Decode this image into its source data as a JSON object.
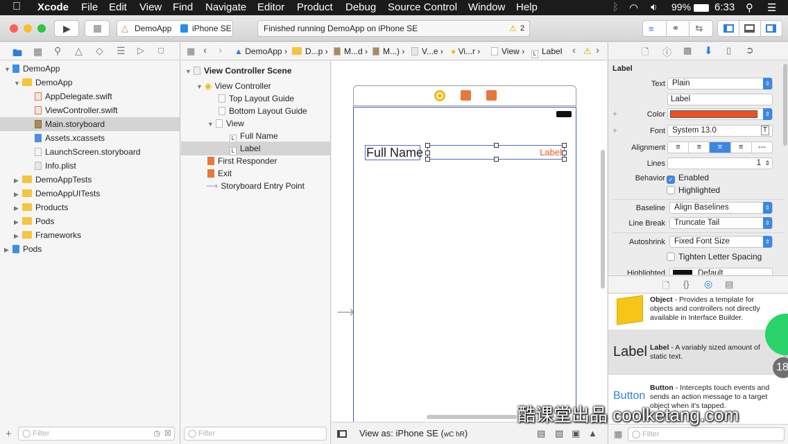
{
  "menubar": {
    "app": "Xcode",
    "items": [
      "File",
      "Edit",
      "View",
      "Find",
      "Navigate",
      "Editor",
      "Product",
      "Debug",
      "Source Control",
      "Window",
      "Help"
    ],
    "battery": "99%",
    "time": "6:33"
  },
  "toolbar": {
    "scheme": "DemoApp",
    "device": "iPhone SE",
    "status": "Finished running DemoApp on iPhone SE",
    "warning_count": "2"
  },
  "navigator": {
    "items": [
      {
        "label": "DemoApp",
        "kind": "project"
      },
      {
        "label": "DemoApp",
        "kind": "folder"
      },
      {
        "label": "AppDelegate.swift",
        "kind": "swift"
      },
      {
        "label": "ViewController.swift",
        "kind": "swift"
      },
      {
        "label": "Main.storyboard",
        "kind": "storyboard"
      },
      {
        "label": "Assets.xcassets",
        "kind": "assets"
      },
      {
        "label": "LaunchScreen.storyboard",
        "kind": "storyboard"
      },
      {
        "label": "Info.plist",
        "kind": "plist"
      },
      {
        "label": "DemoAppTests",
        "kind": "folder"
      },
      {
        "label": "DemoAppUITests",
        "kind": "folder"
      },
      {
        "label": "Products",
        "kind": "folder"
      },
      {
        "label": "Pods",
        "kind": "folder"
      },
      {
        "label": "Frameworks",
        "kind": "folder"
      },
      {
        "label": "Pods",
        "kind": "project"
      }
    ],
    "filter_placeholder": "Filter"
  },
  "jumpbar": [
    "DemoApp",
    "D...p",
    "M...d",
    "M...)",
    "V...e",
    "Vi...r",
    "View",
    "Label"
  ],
  "outline": {
    "items": [
      {
        "label": "View Controller Scene"
      },
      {
        "label": "View Controller"
      },
      {
        "label": "Top Layout Guide"
      },
      {
        "label": "Bottom Layout Guide"
      },
      {
        "label": "View"
      },
      {
        "label": "Full Name"
      },
      {
        "label": "Label"
      },
      {
        "label": "First Responder"
      },
      {
        "label": "Exit"
      },
      {
        "label": "Storyboard Entry Point"
      }
    ],
    "filter_placeholder": "Filter"
  },
  "canvas": {
    "full_name": "Full Name",
    "label": "Label",
    "view_as": "View as: iPhone SE (",
    "size_class": "wC hR",
    "size_class_close": ")"
  },
  "inspector": {
    "section": "Label",
    "text_label": "Text",
    "text_type": "Plain",
    "text_value": "Label",
    "color_label": "Color",
    "color_value": "#f0501e",
    "font_label": "Font",
    "font_value": "System 13.0",
    "alignment_label": "Alignment",
    "lines_label": "Lines",
    "lines_value": "1",
    "behavior_label": "Behavior",
    "enabled": "Enabled",
    "highlighted": "Highlighted",
    "baseline_label": "Baseline",
    "baseline_value": "Align Baselines",
    "linebreak_label": "Line Break",
    "linebreak_value": "Truncate Tail",
    "autoshrink_label": "Autoshrink",
    "autoshrink_value": "Fixed Font Size",
    "tighten": "Tighten Letter Spacing",
    "highlighted_label": "Highlighted",
    "highlighted_value": "Default"
  },
  "library": {
    "items": [
      {
        "preview": "",
        "title": "Object",
        "desc": " - Provides a template for objects and controllers not directly available in Interface Builder."
      },
      {
        "preview": "Label",
        "title": "Label",
        "desc": " - A variably sized amount of static text."
      },
      {
        "preview": "Button",
        "title": "Button",
        "desc": " - Intercepts touch events and sends an action message to a target object when it's tapped."
      }
    ],
    "filter_placeholder": "Filter",
    "badge": "18"
  },
  "watermark": "酷课堂出品 coolketang.com"
}
